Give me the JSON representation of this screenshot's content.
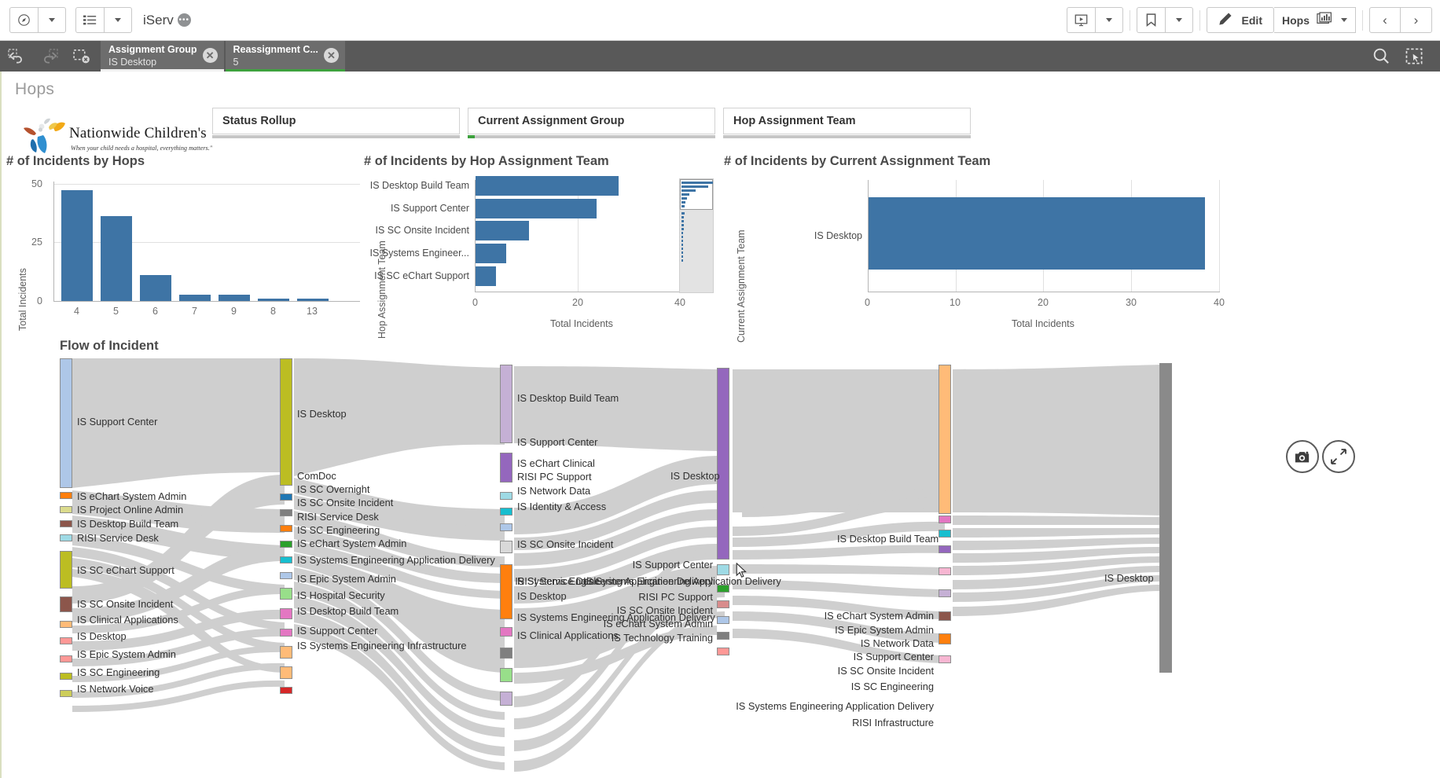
{
  "toolbar": {
    "nav_icon": "compass-icon",
    "sheets_icon": "list-icon",
    "app_name": "iServ",
    "app_badge": "•••",
    "story_icon": "storytelling-icon",
    "bookmark_icon": "bookmark-icon",
    "edit_icon": "pencil-icon",
    "edit_label": "Edit",
    "sheet_label": "Hops",
    "sheet_icon": "sheets-icon",
    "prev_label": "‹",
    "next_label": "›"
  },
  "selection_bar": {
    "back_icon": "step-back-icon",
    "forward_icon": "step-forward-icon",
    "clear_icon": "clear-selections-icon",
    "search_icon": "search-icon",
    "selections_icon": "selections-tool-icon",
    "chips": [
      {
        "field": "Assignment Group",
        "value": "IS Desktop",
        "state": "white"
      },
      {
        "field": "Reassignment C...",
        "value": "5",
        "state": "green"
      }
    ]
  },
  "sheet": {
    "title": "Hops"
  },
  "logo": {
    "line1": "Nationwide Children's",
    "tagline": "When your child needs a hospital, everything matters.\""
  },
  "filters": [
    {
      "label": "Status Rollup",
      "progress": 0
    },
    {
      "label": "Current Assignment Group",
      "progress": 3
    },
    {
      "label": "Hop Assignment Team",
      "progress": 0
    }
  ],
  "chart_data": [
    {
      "type": "bar",
      "title": "# of Incidents by Hops",
      "xlabel": "",
      "ylabel": "Total Incidents",
      "categories": [
        "4",
        "5",
        "6",
        "7",
        "9",
        "8",
        "13"
      ],
      "values": [
        51,
        39,
        12,
        3,
        3,
        1,
        1
      ],
      "ylim": [
        0,
        55
      ],
      "yticks": [
        0,
        25,
        50
      ],
      "grid": true,
      "legend": "none",
      "color": "#3e74a5"
    },
    {
      "type": "bar",
      "orientation": "horizontal",
      "title": "# of Incidents by Hop Assignment Team",
      "xlabel": "Total Incidents",
      "ylabel": "Hop Assignment Team",
      "categories": [
        "IS Desktop Build Team",
        "IS Support Center",
        "IS SC Onsite Incident",
        "IS Systems Engineer...",
        "IS SC eChart Support"
      ],
      "values": [
        28,
        23.5,
        10.5,
        6,
        4
      ],
      "xlim": [
        0,
        42
      ],
      "xticks": [
        0,
        20,
        40
      ],
      "grid": true,
      "legend": "none",
      "color": "#3e74a5",
      "has_scroll_minimap": true,
      "minimap_values": [
        47,
        40,
        21,
        12,
        8,
        5,
        4,
        3,
        3,
        2,
        2,
        2,
        2,
        2,
        1,
        1,
        1,
        1,
        1,
        1,
        1,
        1,
        1
      ]
    },
    {
      "type": "bar",
      "orientation": "horizontal",
      "title": "# of Incidents by Current Assignment Team",
      "xlabel": "Total Incidents",
      "ylabel": "Current Assignment Team",
      "categories": [
        "IS Desktop"
      ],
      "values": [
        38.5
      ],
      "xlim": [
        0,
        40
      ],
      "xticks": [
        0,
        10,
        20,
        30,
        40
      ],
      "grid": true,
      "legend": "none",
      "color": "#3e74a5"
    }
  ],
  "sankey": {
    "title": "Flow of Incident",
    "columns": [
      {
        "name": "column-1",
        "nodes": [
          {
            "label": "IS Support Center",
            "color": "#aec7e8",
            "big": true
          },
          {
            "label": "IS eChart System Admin",
            "color": "#ff7f0e"
          },
          {
            "label": "IS Project Online Admin",
            "color": "#dbdb8d"
          },
          {
            "label": "IS Desktop Build Team",
            "color": "#8c564b"
          },
          {
            "label": "RISI Service Desk",
            "color": "#9edae5"
          },
          {
            "label": "IS SC eChart Support",
            "color": "#bcbd22",
            "big": true
          },
          {
            "label": "IS SC Onsite Incident",
            "color": "#8c564b"
          },
          {
            "label": "IS Clinical Applications",
            "color": "#ffbb78"
          },
          {
            "label": "IS Desktop",
            "color": "#ff9896"
          },
          {
            "label": "IS Epic System Admin",
            "color": "#ff9896"
          },
          {
            "label": "IS SC Engineering",
            "color": "#bcbd22"
          },
          {
            "label": "IS Network Voice",
            "color": "#cdcd5a"
          }
        ]
      },
      {
        "name": "column-2",
        "nodes": [
          {
            "label": "IS Desktop",
            "color": "#bcbd22",
            "big": true
          },
          {
            "label": "ComDoc",
            "color": "#1f77b4"
          },
          {
            "label": "IS SC Overnight",
            "color": "#7f7f7f"
          },
          {
            "label": "IS SC Onsite Incident",
            "color": "#ff7f0e"
          },
          {
            "label": "RISI Service Desk",
            "color": "#2ca02c"
          },
          {
            "label": "IS SC Engineering",
            "color": "#17becf"
          },
          {
            "label": "IS eChart System Admin",
            "color": "#aec7e8"
          },
          {
            "label": "IS Systems Engineering Application Delivery",
            "color": "#98df8a"
          },
          {
            "label": "IS Epic System Admin",
            "color": "#e377c2"
          },
          {
            "label": "IS Hospital Security",
            "color": "#e377c2"
          },
          {
            "label": "IS Desktop Build Team",
            "color": "#ffbb78"
          },
          {
            "label": "IS Support Center",
            "color": "#ffbb78"
          },
          {
            "label": "IS Systems Engineering Infrastructure",
            "color": "#d62728"
          }
        ]
      },
      {
        "name": "column-3",
        "nodes": [
          {
            "label": "IS Desktop Build Team",
            "color": "#c5b0d5",
            "big": true
          },
          {
            "label": "IS Support Center",
            "color": "#9467bd",
            "big": true
          },
          {
            "label": "IS eChart Clinical",
            "color": "#9edae5"
          },
          {
            "label": "RISI PC Support",
            "color": "#17becf"
          },
          {
            "label": "IS Network Data",
            "color": "#aec7e8"
          },
          {
            "label": "IS Identity & Access",
            "color": "#d9d9d9"
          },
          {
            "label": "IS SC Onsite Incident",
            "color": "#ff7f0e",
            "big": true
          },
          {
            "label": "RISI Service Desk",
            "color": "#e377c2"
          },
          {
            "label": "IS Systems Engineering Application Delivery",
            "color": "#e377c2"
          },
          {
            "label": "IS Desktop",
            "color": "#7f7f7f"
          },
          {
            "label": "IS Systems Engineering Application Delivery",
            "color": "#98df8a"
          },
          {
            "label": "IS Clinical Applications",
            "color": "#c5b0d5"
          }
        ]
      },
      {
        "name": "column-4",
        "nodes": [
          {
            "label": "IS Desktop",
            "color": "#9467bd",
            "big": true
          },
          {
            "label": "IS Support Center",
            "color": "#9edae5"
          },
          {
            "label": "IS Systems Engineering Application Delivery",
            "color": "#2ca02c"
          },
          {
            "label": "RISI PC Support",
            "color": "#d88c8c"
          },
          {
            "label": "IS SC Onsite Incident",
            "color": "#aec7e8"
          },
          {
            "label": "IS eChart System Admin",
            "color": "#7f7f7f"
          },
          {
            "label": "IS Technology Training",
            "color": "#ff9896"
          }
        ]
      },
      {
        "name": "column-5",
        "nodes": [
          {
            "label": "IS Desktop Build Team",
            "color": "#ffbb78",
            "big": true
          },
          {
            "label": "IS eChart System Admin",
            "color": "#e377c2"
          },
          {
            "label": "IS Epic System Admin",
            "color": "#17becf"
          },
          {
            "label": "IS Network Data",
            "color": "#9467bd"
          },
          {
            "label": "IS Support Center",
            "color": "#f7b6d2"
          },
          {
            "label": "IS SC Onsite Incident",
            "color": "#c5b0d5"
          },
          {
            "label": "IS SC Engineering",
            "color": "#8c564b"
          },
          {
            "label": "IS Systems Engineering Application Delivery",
            "color": "#ff7f0e"
          },
          {
            "label": "RISI Infrastructure",
            "color": "#f7b6d2"
          }
        ]
      },
      {
        "name": "column-6",
        "nodes": [
          {
            "label": "IS Desktop",
            "color": "#8a8a8a",
            "big": true
          }
        ]
      }
    ]
  },
  "floating": {
    "snapshot_icon": "camera-icon",
    "fullscreen_icon": "expand-icon"
  }
}
